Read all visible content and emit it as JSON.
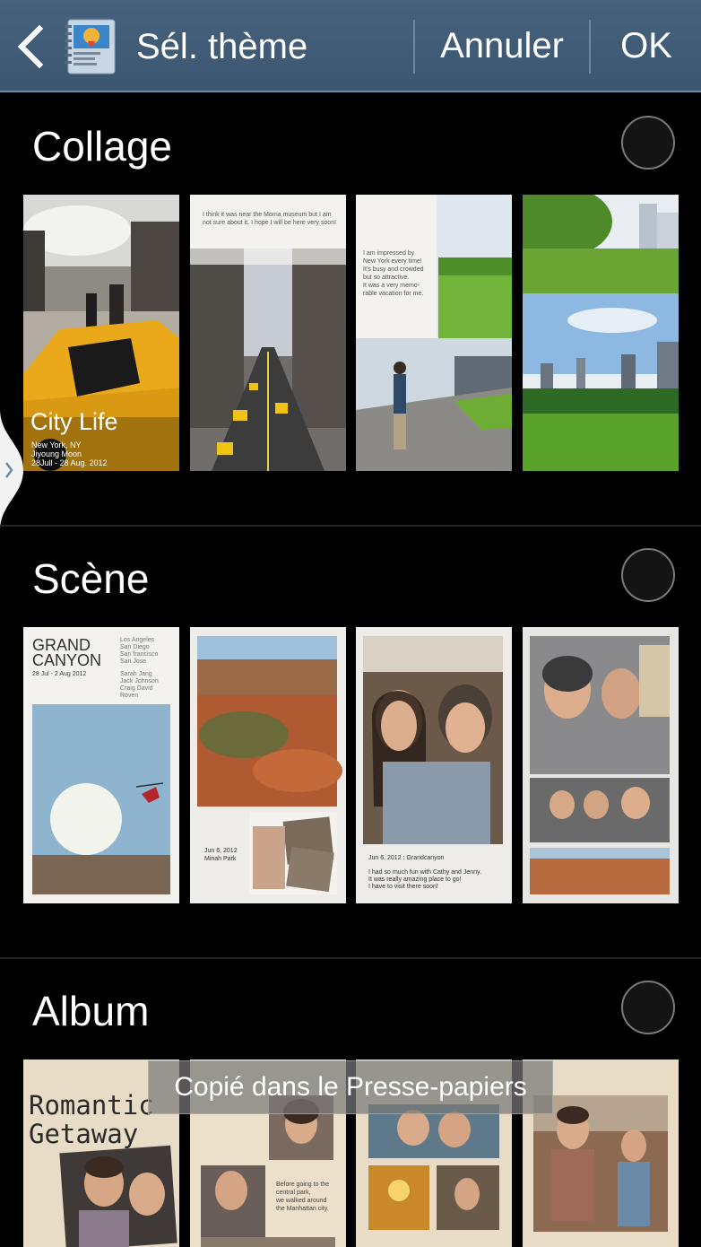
{
  "header": {
    "title": "Sél. thème",
    "cancel_label": "Annuler",
    "ok_label": "OK"
  },
  "sections": [
    {
      "title": "Collage",
      "thumbs": [
        {
          "caption": "City Life",
          "sub1": "New York, NY",
          "sub2": "Jiyoung Moon",
          "sub3": "28Jull - 28 Aug. 2012"
        },
        {
          "text1": "I think it was near the Moma museum but I am",
          "text2": "not sure about it. I hope I will be here very soon!"
        },
        {
          "text1": "I am impressed by",
          "text2": "New York every time!",
          "text3": "It's busy and crowded",
          "text4": "but so attractive.",
          "text5": "It was a very memo-",
          "text6": "rable vacation for me."
        },
        {}
      ]
    },
    {
      "title": "Scène",
      "thumbs": [
        {
          "t1": "GRAND",
          "t2": "CANYON",
          "date": "28 Jul - 2 Aug 2012",
          "cities": [
            "Los Angeles",
            "San Diego",
            "San francisco",
            "San Jose"
          ],
          "names": [
            "Sarah Jang",
            "Jack Johnson",
            "Craig David",
            "Roven"
          ]
        },
        {
          "d1": "Jun 6, 2012",
          "d2": "Minah Park"
        },
        {
          "d1": "Jun 6, 2012 : Grandcanyon",
          "l1": "I had so much fun with Cathy and Jenny.",
          "l2": "It was really amazing place to go!",
          "l3": "I have to visit there soon!"
        },
        {}
      ]
    },
    {
      "title": "Album",
      "thumbs": [
        {
          "t1": "Romantic",
          "t2": "Getaway"
        },
        {
          "l1": "Before going to the",
          "l2": "central park,",
          "l3": "we walked around",
          "l4": "the Manhattan city."
        },
        {},
        {}
      ]
    }
  ],
  "toast": "Copié dans le Presse-papiers"
}
